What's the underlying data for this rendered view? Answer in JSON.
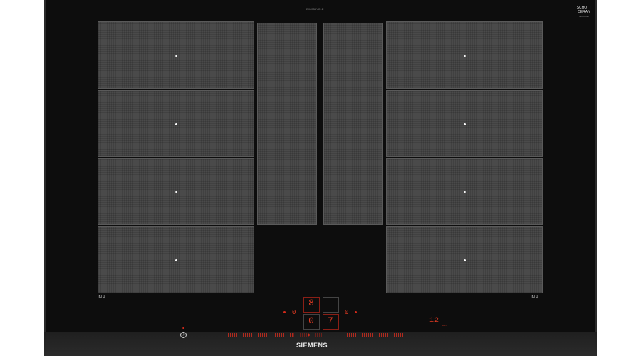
{
  "cooktop": {
    "model_label": "EX875LYC1E",
    "glass_brand_line1": "SCHOTT",
    "glass_brand_line2": "CERAN",
    "glass_brand_sub": "xxxxxxxxx",
    "brand": "SIEMENS",
    "left_flex_label": "IN ⫰",
    "right_flex_label": "IN ⫰",
    "power_symbol": "ⓘ",
    "display_main": "8",
    "display_left": "0",
    "display_right": "7",
    "indicator_left": "0",
    "indicator_right": "0",
    "timer_value": "12",
    "timer_unit": "min"
  },
  "colors": {
    "glass": "#0d0d0d",
    "zone": "#4a4a4a",
    "led_red": "#e03a22"
  }
}
